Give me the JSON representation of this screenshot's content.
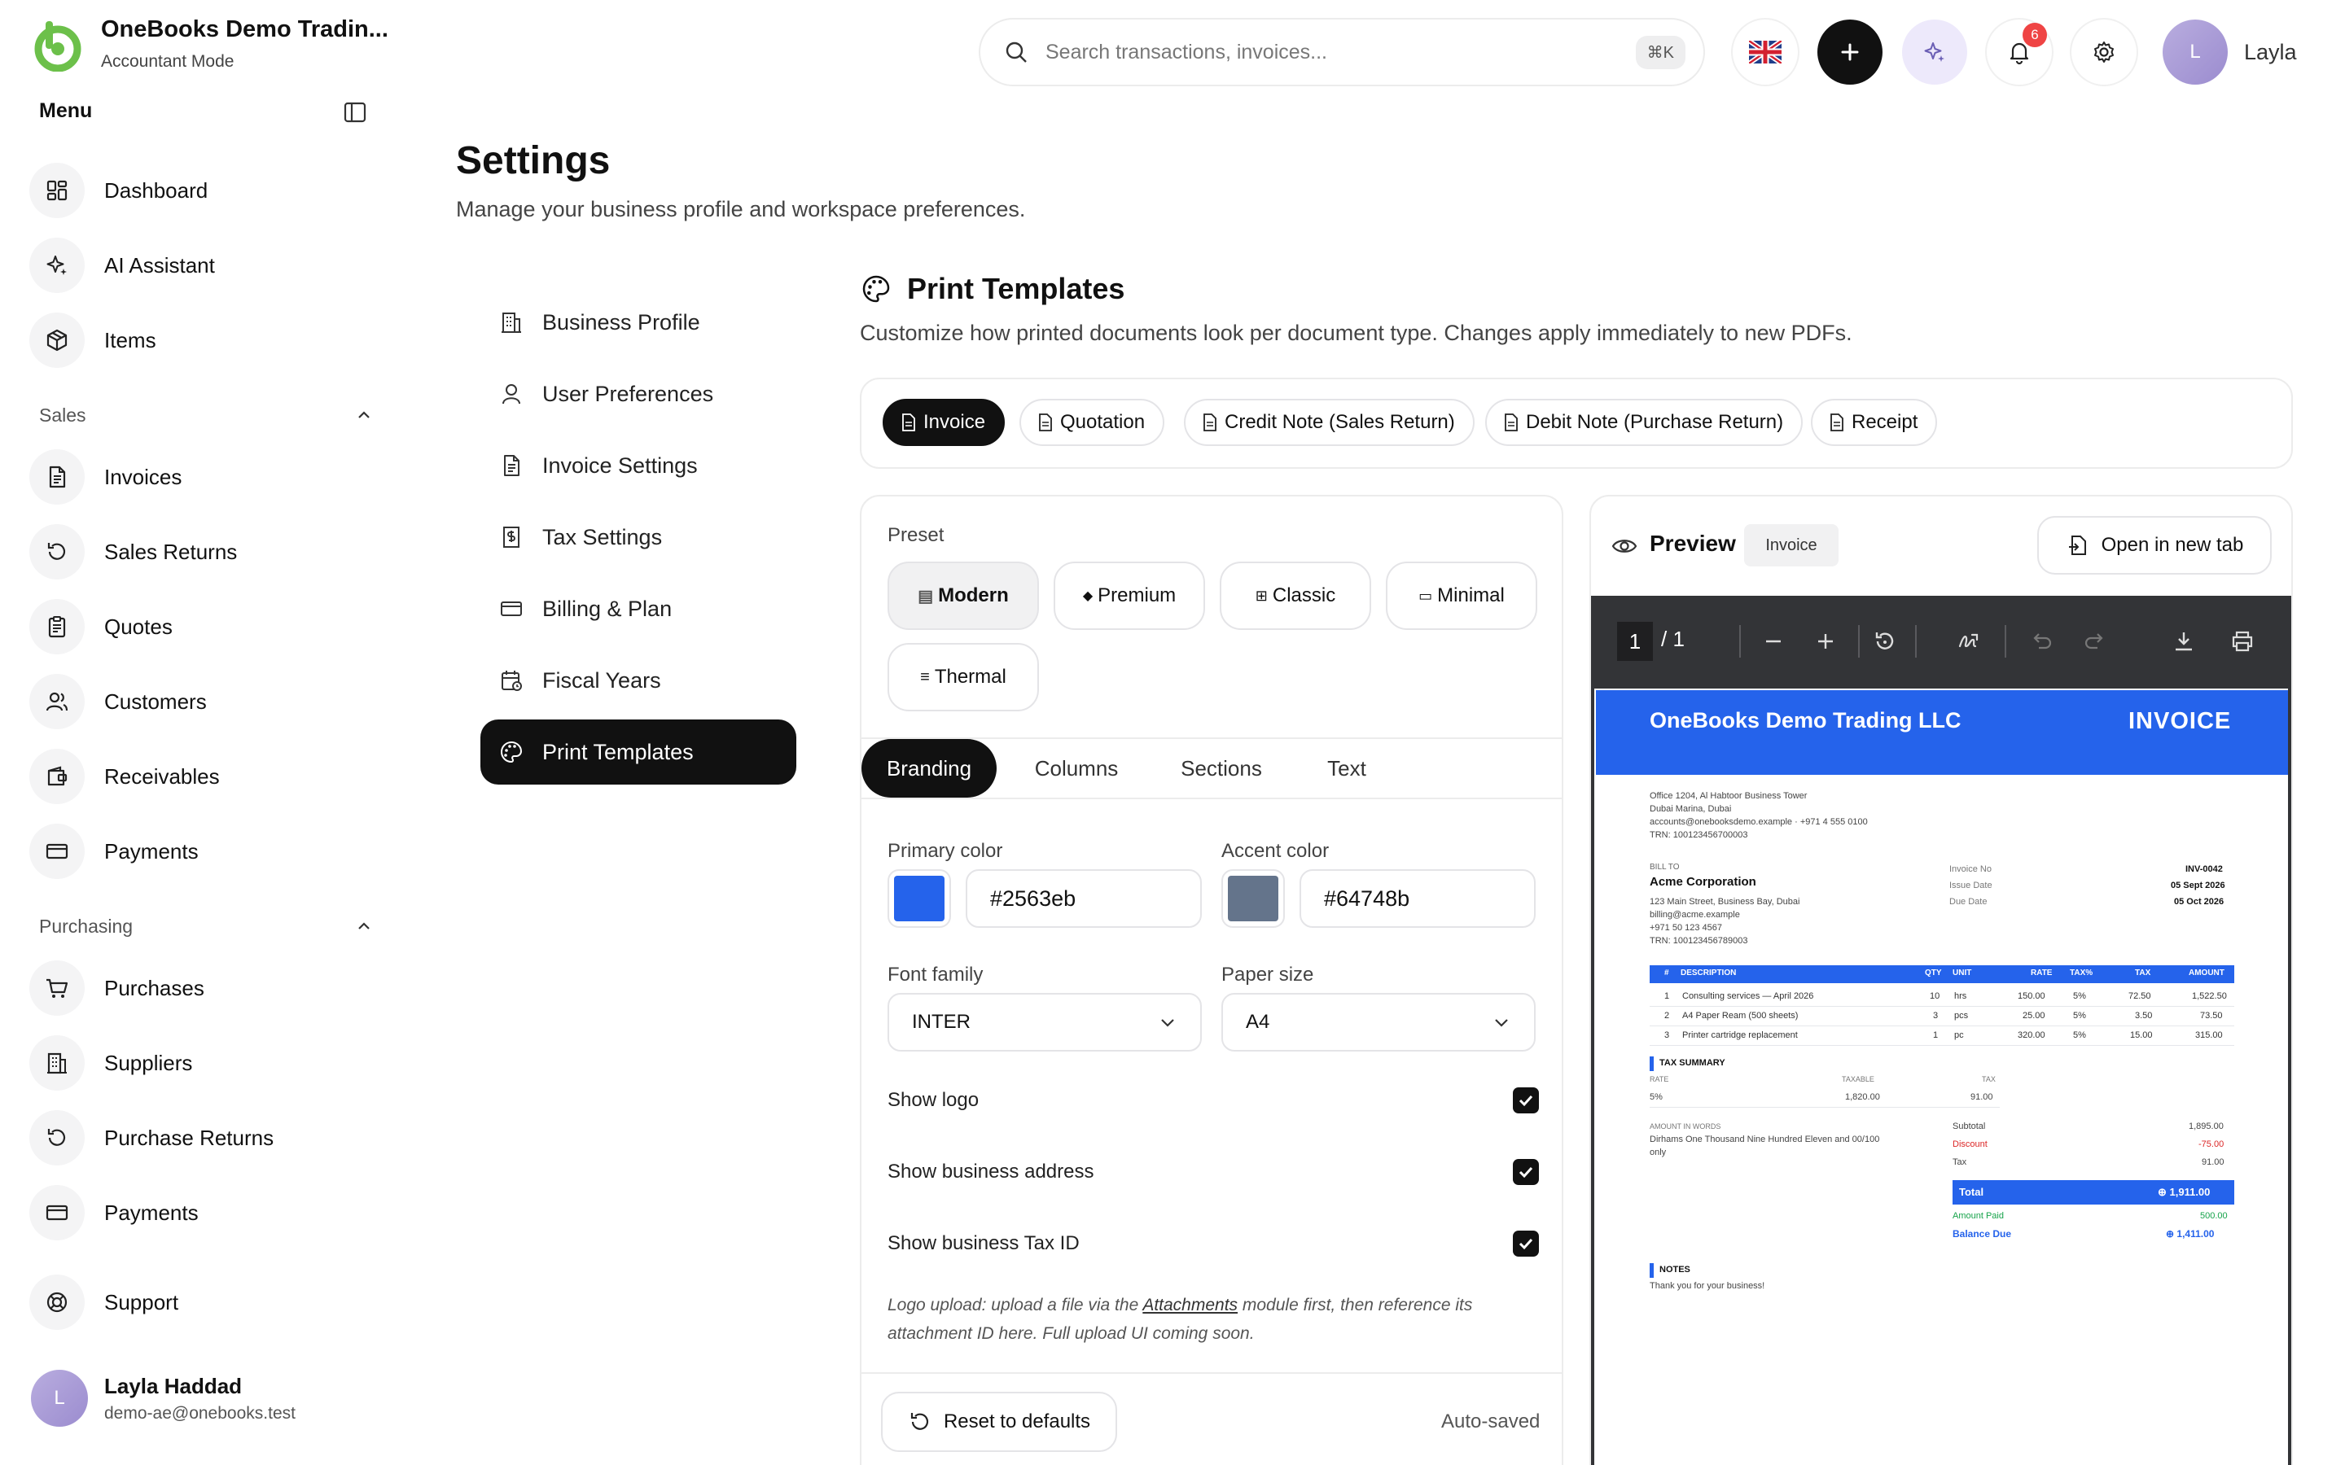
{
  "app": {
    "name": "OneBooks Demo Tradin...",
    "mode": "Accountant Mode",
    "menu_title": "Menu"
  },
  "sidebar": {
    "top_items": [
      {
        "label": "Dashboard",
        "icon": "dashboard-icon"
      },
      {
        "label": "AI Assistant",
        "icon": "sparkles-icon"
      },
      {
        "label": "Items",
        "icon": "box-icon"
      }
    ],
    "sales": {
      "title": "Sales",
      "items": [
        {
          "label": "Invoices",
          "icon": "file-text-icon"
        },
        {
          "label": "Sales Returns",
          "icon": "rotate-ccw-icon"
        },
        {
          "label": "Quotes",
          "icon": "clipboard-icon"
        },
        {
          "label": "Customers",
          "icon": "users-icon"
        },
        {
          "label": "Receivables",
          "icon": "wallet-icon"
        },
        {
          "label": "Payments",
          "icon": "credit-card-icon"
        }
      ]
    },
    "purchasing": {
      "title": "Purchasing",
      "items": [
        {
          "label": "Purchases",
          "icon": "cart-icon"
        },
        {
          "label": "Suppliers",
          "icon": "building-icon"
        },
        {
          "label": "Purchase Returns",
          "icon": "rotate-ccw-icon"
        },
        {
          "label": "Payments",
          "icon": "credit-card-icon"
        }
      ]
    },
    "support": {
      "label": "Support",
      "icon": "lifebuoy-icon"
    },
    "user": {
      "initial": "L",
      "name": "Layla Haddad",
      "email": "demo-ae@onebooks.test"
    }
  },
  "topbar": {
    "search_placeholder": "Search transactions, invoices...",
    "shortcut": "⌘K",
    "notification_count": "6",
    "user_initial": "L",
    "user_name": "Layla"
  },
  "page": {
    "title": "Settings",
    "subtitle": "Manage your business profile and workspace preferences."
  },
  "settings_nav": [
    {
      "label": "Business Profile",
      "icon": "building-icon"
    },
    {
      "label": "User Preferences",
      "icon": "user-icon"
    },
    {
      "label": "Invoice Settings",
      "icon": "file-text-icon"
    },
    {
      "label": "Tax Settings",
      "icon": "receipt-icon"
    },
    {
      "label": "Billing & Plan",
      "icon": "credit-card-icon"
    },
    {
      "label": "Fiscal Years",
      "icon": "calendar-icon"
    },
    {
      "label": "Print Templates",
      "icon": "palette-icon",
      "active": true
    }
  ],
  "print_templates": {
    "title": "Print Templates",
    "description": "Customize how printed documents look per document type. Changes apply immediately to new PDFs.",
    "doc_tabs": [
      "Invoice",
      "Quotation",
      "Credit Note (Sales Return)",
      "Debit Note (Purchase Return)",
      "Receipt"
    ],
    "active_doc_tab": "Invoice",
    "preset_label": "Preset",
    "presets": [
      {
        "label": "Modern",
        "glyph": "▤"
      },
      {
        "label": "Premium",
        "glyph": "◆"
      },
      {
        "label": "Classic",
        "glyph": "⊞"
      },
      {
        "label": "Minimal",
        "glyph": "▭"
      },
      {
        "label": "Thermal",
        "glyph": "≡"
      }
    ],
    "active_preset": "Modern",
    "section_tabs": [
      "Branding",
      "Columns",
      "Sections",
      "Text"
    ],
    "active_section_tab": "Branding",
    "primary_color_label": "Primary color",
    "primary_color": "#2563eb",
    "accent_color_label": "Accent color",
    "accent_color": "#64748b",
    "font_family_label": "Font family",
    "font_family": "INTER",
    "paper_size_label": "Paper size",
    "paper_size": "A4",
    "checks": [
      {
        "label": "Show logo",
        "checked": true
      },
      {
        "label": "Show business address",
        "checked": true
      },
      {
        "label": "Show business Tax ID",
        "checked": true
      }
    ],
    "note_before": "Logo upload: upload a file via the ",
    "note_link": "Attachments",
    "note_after": " module first, then reference its attachment ID here. Full upload UI coming soon.",
    "reset_label": "Reset to defaults",
    "autosaved": "Auto-saved"
  },
  "preview": {
    "title": "Preview",
    "badge": "Invoice",
    "open_new_tab": "Open in new tab",
    "page_current": "1",
    "page_total": "/ 1"
  },
  "invoice_doc": {
    "company": "OneBooks Demo Trading LLC",
    "doc_title": "INVOICE",
    "address_lines": [
      "Office 1204, Al Habtoor Business Tower",
      "Dubai Marina, Dubai",
      "accounts@onebooksdemo.example  ·  +971 4 555 0100",
      "TRN: 100123456700003"
    ],
    "bill_to_label": "BILL TO",
    "customer": "Acme Corporation",
    "customer_lines": [
      "123 Main Street, Business Bay, Dubai",
      "billing@acme.example",
      "+971 50 123 4567",
      "TRN: 100123456789003"
    ],
    "meta": [
      {
        "label": "Invoice No",
        "value": "INV-0042"
      },
      {
        "label": "Issue Date",
        "value": "05 Sept 2026"
      },
      {
        "label": "Due Date",
        "value": "05 Oct 2026"
      }
    ],
    "columns": [
      "#",
      "DESCRIPTION",
      "QTY",
      "UNIT",
      "RATE",
      "TAX%",
      "TAX",
      "AMOUNT"
    ],
    "rows": [
      [
        "1",
        "Consulting services — April 2026",
        "10",
        "hrs",
        "150.00",
        "5%",
        "72.50",
        "1,522.50"
      ],
      [
        "2",
        "A4 Paper Ream (500 sheets)",
        "3",
        "pcs",
        "25.00",
        "5%",
        "3.50",
        "73.50"
      ],
      [
        "3",
        "Printer cartridge replacement",
        "1",
        "pc",
        "320.00",
        "5%",
        "15.00",
        "315.00"
      ]
    ],
    "tax_summary_title": "TAX SUMMARY",
    "tax_summary_cols": [
      "RATE",
      "TAXABLE",
      "TAX"
    ],
    "tax_summary_row": [
      "5%",
      "1,820.00",
      "91.00"
    ],
    "words_label": "AMOUNT IN WORDS",
    "words_line1": "Dirhams One Thousand Nine Hundred Eleven and 00/100",
    "words_line2": "only",
    "subtotal_label": "Subtotal",
    "subtotal": "1,895.00",
    "discount_label": "Discount",
    "discount": "-75.00",
    "tax_label": "Tax",
    "tax": "91.00",
    "total_label": "Total",
    "total": "⊕ 1,911.00",
    "paid_label": "Amount Paid",
    "paid": "500.00",
    "balance_label": "Balance Due",
    "balance": "⊕ 1,411.00",
    "notes_title": "NOTES",
    "notes_text": "Thank you for your business!"
  }
}
